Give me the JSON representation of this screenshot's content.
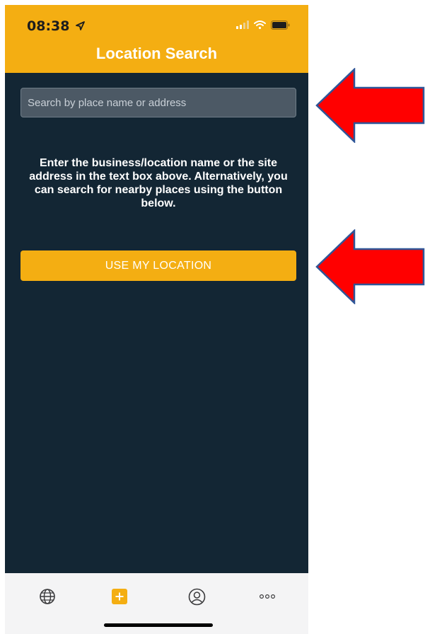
{
  "status_bar": {
    "time": "08:38",
    "location_icon": "location-arrow-icon",
    "signal_icon": "cellular-signal-icon",
    "wifi_icon": "wifi-icon",
    "battery_icon": "battery-icon"
  },
  "header": {
    "title": "Location Search"
  },
  "search": {
    "placeholder": "Search by place name or address",
    "value": ""
  },
  "instructions": {
    "text": "Enter the business/location name or the site address in the text box above. Alternatively, you can search for nearby places using the button below."
  },
  "location_button": {
    "label": "USE MY LOCATION"
  },
  "tab_bar": {
    "items": [
      {
        "icon": "globe-icon"
      },
      {
        "icon": "add-icon"
      },
      {
        "icon": "profile-icon"
      },
      {
        "icon": "more-icon"
      }
    ]
  },
  "colors": {
    "accent": "#f4ae12",
    "background": "#132634",
    "search_field": "#4c5965",
    "annotation_arrow": "#ff0000",
    "annotation_arrow_outline": "#2f5597"
  }
}
